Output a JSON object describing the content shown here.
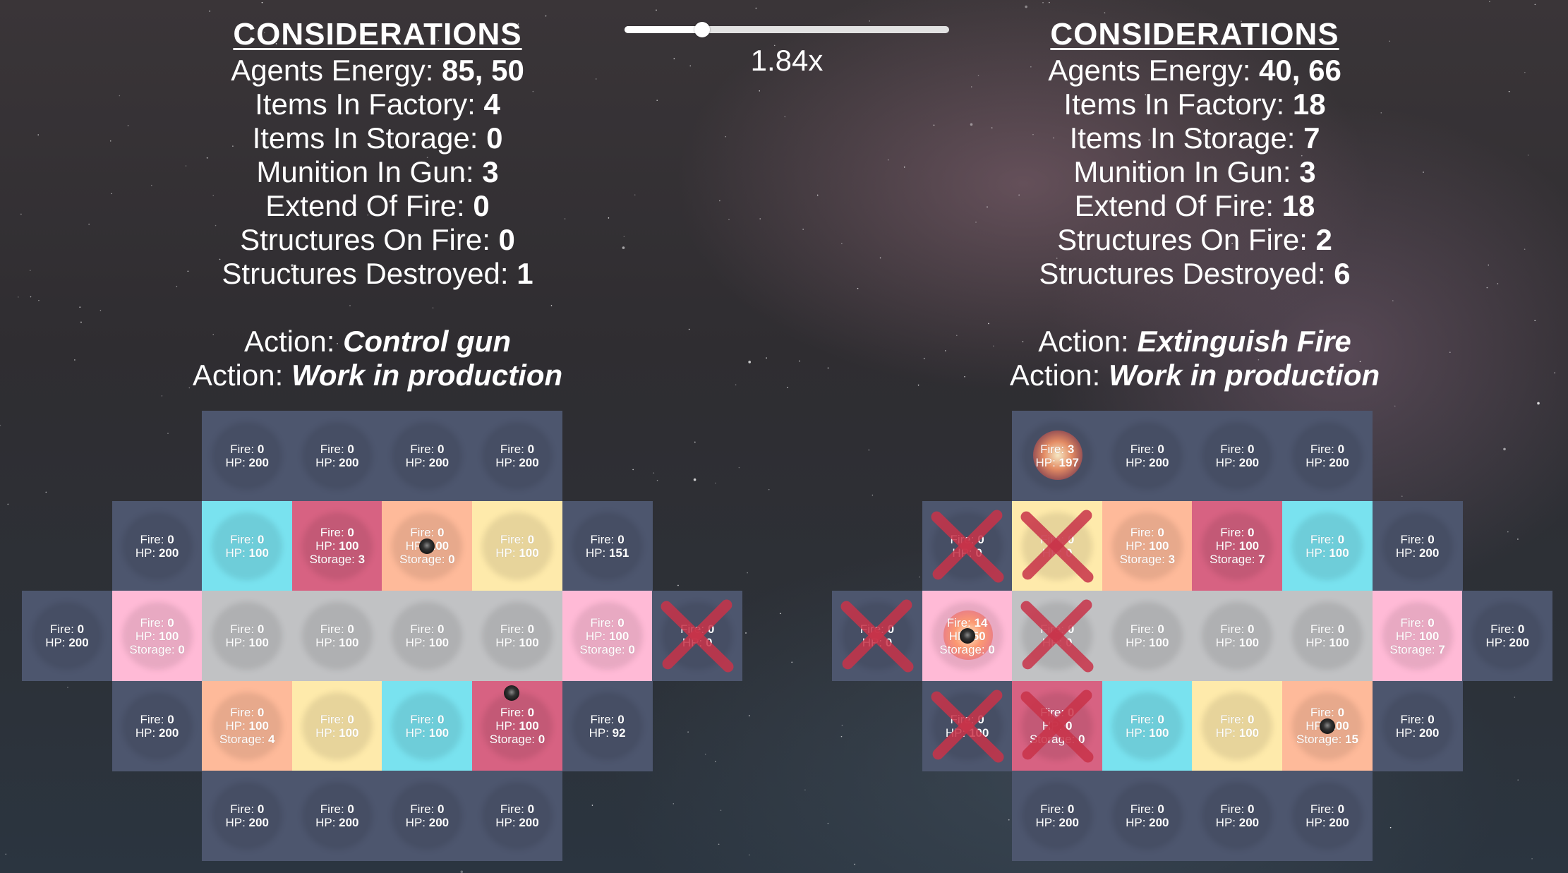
{
  "speed_slider": {
    "value_fraction": 0.24,
    "label": "1.84x"
  },
  "left_panel": {
    "title": "CONSIDERATIONS",
    "stats": [
      {
        "label": "Agents Energy: ",
        "value": "85, 50"
      },
      {
        "label": "Items In Factory: ",
        "value": "4"
      },
      {
        "label": "Items In Storage: ",
        "value": "0"
      },
      {
        "label": "Munition In Gun: ",
        "value": "3"
      },
      {
        "label": "Extend Of Fire: ",
        "value": "0"
      },
      {
        "label": "Structures On Fire: ",
        "value": "0"
      },
      {
        "label": "Structures Destroyed: ",
        "value": "1"
      }
    ],
    "actions": [
      {
        "label": "Action: ",
        "value": "Control gun"
      },
      {
        "label": "Action: ",
        "value": "Work in production"
      }
    ]
  },
  "right_panel": {
    "title": "CONSIDERATIONS",
    "stats": [
      {
        "label": "Agents Energy: ",
        "value": "40, 66"
      },
      {
        "label": "Items In Factory: ",
        "value": "18"
      },
      {
        "label": "Items In Storage: ",
        "value": "7"
      },
      {
        "label": "Munition In Gun: ",
        "value": "3"
      },
      {
        "label": "Extend Of Fire: ",
        "value": "18"
      },
      {
        "label": "Structures On Fire: ",
        "value": "2"
      },
      {
        "label": "Structures Destroyed: ",
        "value": "6"
      }
    ],
    "actions": [
      {
        "label": "Action: ",
        "value": "Extinguish Fire"
      },
      {
        "label": "Action: ",
        "value": "Work in production"
      }
    ]
  },
  "colors": {
    "navy": "#4d566e",
    "cyan": "#79e2ef",
    "red": "#d76282",
    "orange": "#feba9a",
    "yellow": "#feeaab",
    "gray": "#c1c2c4",
    "pink": "#ffbad6",
    "destroyed_x": "#c93349"
  },
  "labels": {
    "fire": "Fire: ",
    "hp": "HP: ",
    "storage": "Storage: "
  },
  "grids": [
    {
      "rows": [
        [
          null,
          null,
          {
            "c": "navy",
            "fire": 0,
            "hp": 200
          },
          {
            "c": "navy",
            "fire": 0,
            "hp": 200
          },
          {
            "c": "navy",
            "fire": 0,
            "hp": 200
          },
          {
            "c": "navy",
            "fire": 0,
            "hp": 200
          },
          null,
          null
        ],
        [
          null,
          {
            "c": "navy",
            "fire": 0,
            "hp": 200
          },
          {
            "c": "cyan",
            "fire": 0,
            "hp": 100
          },
          {
            "c": "red",
            "fire": 0,
            "hp": 100,
            "storage": 3
          },
          {
            "c": "orange",
            "fire": 0,
            "hp": 100,
            "storage": 0,
            "bomb": true
          },
          {
            "c": "yellow",
            "fire": 0,
            "hp": 100
          },
          {
            "c": "navy",
            "fire": 0,
            "hp": 151
          },
          null
        ],
        [
          {
            "c": "navy",
            "fire": 0,
            "hp": 200
          },
          {
            "c": "pink",
            "fire": 0,
            "hp": 100,
            "storage": 0
          },
          {
            "c": "gray",
            "fire": 0,
            "hp": 100
          },
          {
            "c": "gray",
            "fire": 0,
            "hp": 100
          },
          {
            "c": "gray",
            "fire": 0,
            "hp": 100
          },
          {
            "c": "gray",
            "fire": 0,
            "hp": 100
          },
          {
            "c": "pink",
            "fire": 0,
            "hp": 100,
            "storage": 0
          },
          {
            "c": "navy",
            "fire": 0,
            "hp": 0,
            "destroyed": true
          }
        ],
        [
          null,
          {
            "c": "navy",
            "fire": 0,
            "hp": 200
          },
          {
            "c": "orange",
            "fire": 0,
            "hp": 100,
            "storage": 4
          },
          {
            "c": "yellow",
            "fire": 0,
            "hp": 100
          },
          {
            "c": "cyan",
            "fire": 0,
            "hp": 100
          },
          {
            "c": "red",
            "fire": 0,
            "hp": 100,
            "storage": 0,
            "bomb_top": true
          },
          {
            "c": "navy",
            "fire": 0,
            "hp": 92
          },
          null
        ],
        [
          null,
          null,
          {
            "c": "navy",
            "fire": 0,
            "hp": 200
          },
          {
            "c": "navy",
            "fire": 0,
            "hp": 200
          },
          {
            "c": "navy",
            "fire": 0,
            "hp": 200
          },
          {
            "c": "navy",
            "fire": 0,
            "hp": 200
          },
          null,
          null
        ]
      ]
    },
    {
      "rows": [
        [
          null,
          null,
          {
            "c": "navy",
            "fire": 3,
            "hp": 197,
            "burning": true
          },
          {
            "c": "navy",
            "fire": 0,
            "hp": 200
          },
          {
            "c": "navy",
            "fire": 0,
            "hp": 200
          },
          {
            "c": "navy",
            "fire": 0,
            "hp": 200
          },
          null,
          null
        ],
        [
          null,
          {
            "c": "navy",
            "fire": 0,
            "hp": 0,
            "destroyed": true
          },
          {
            "c": "yellow",
            "fire": 0,
            "hp": 0,
            "destroyed": true
          },
          {
            "c": "orange",
            "fire": 0,
            "hp": 100,
            "storage": 3
          },
          {
            "c": "red",
            "fire": 0,
            "hp": 100,
            "storage": 7
          },
          {
            "c": "cyan",
            "fire": 0,
            "hp": 100
          },
          {
            "c": "navy",
            "fire": 0,
            "hp": 200
          },
          null
        ],
        [
          {
            "c": "navy",
            "fire": 0,
            "hp": 0,
            "destroyed": true
          },
          {
            "c": "pink",
            "fire": 14,
            "hp": 50,
            "storage": 0,
            "burning": true,
            "bomb": true
          },
          {
            "c": "gray",
            "fire": 0,
            "hp": 0,
            "destroyed": true
          },
          {
            "c": "gray",
            "fire": 0,
            "hp": 100
          },
          {
            "c": "gray",
            "fire": 0,
            "hp": 100
          },
          {
            "c": "gray",
            "fire": 0,
            "hp": 100
          },
          {
            "c": "pink",
            "fire": 0,
            "hp": 100,
            "storage": 7
          },
          {
            "c": "navy",
            "fire": 0,
            "hp": 200
          }
        ],
        [
          null,
          {
            "c": "navy",
            "fire": 0,
            "hp": 100,
            "destroyed": true
          },
          {
            "c": "red",
            "fire": 0,
            "hp": 0,
            "storage": 0,
            "destroyed": true
          },
          {
            "c": "cyan",
            "fire": 0,
            "hp": 100
          },
          {
            "c": "yellow",
            "fire": 0,
            "hp": 100
          },
          {
            "c": "orange",
            "fire": 0,
            "hp": 100,
            "storage": 15,
            "bomb": true
          },
          {
            "c": "navy",
            "fire": 0,
            "hp": 200
          },
          null
        ],
        [
          null,
          null,
          {
            "c": "navy",
            "fire": 0,
            "hp": 200
          },
          {
            "c": "navy",
            "fire": 0,
            "hp": 200
          },
          {
            "c": "navy",
            "fire": 0,
            "hp": 200
          },
          {
            "c": "navy",
            "fire": 0,
            "hp": 200
          },
          null,
          null
        ]
      ]
    }
  ]
}
